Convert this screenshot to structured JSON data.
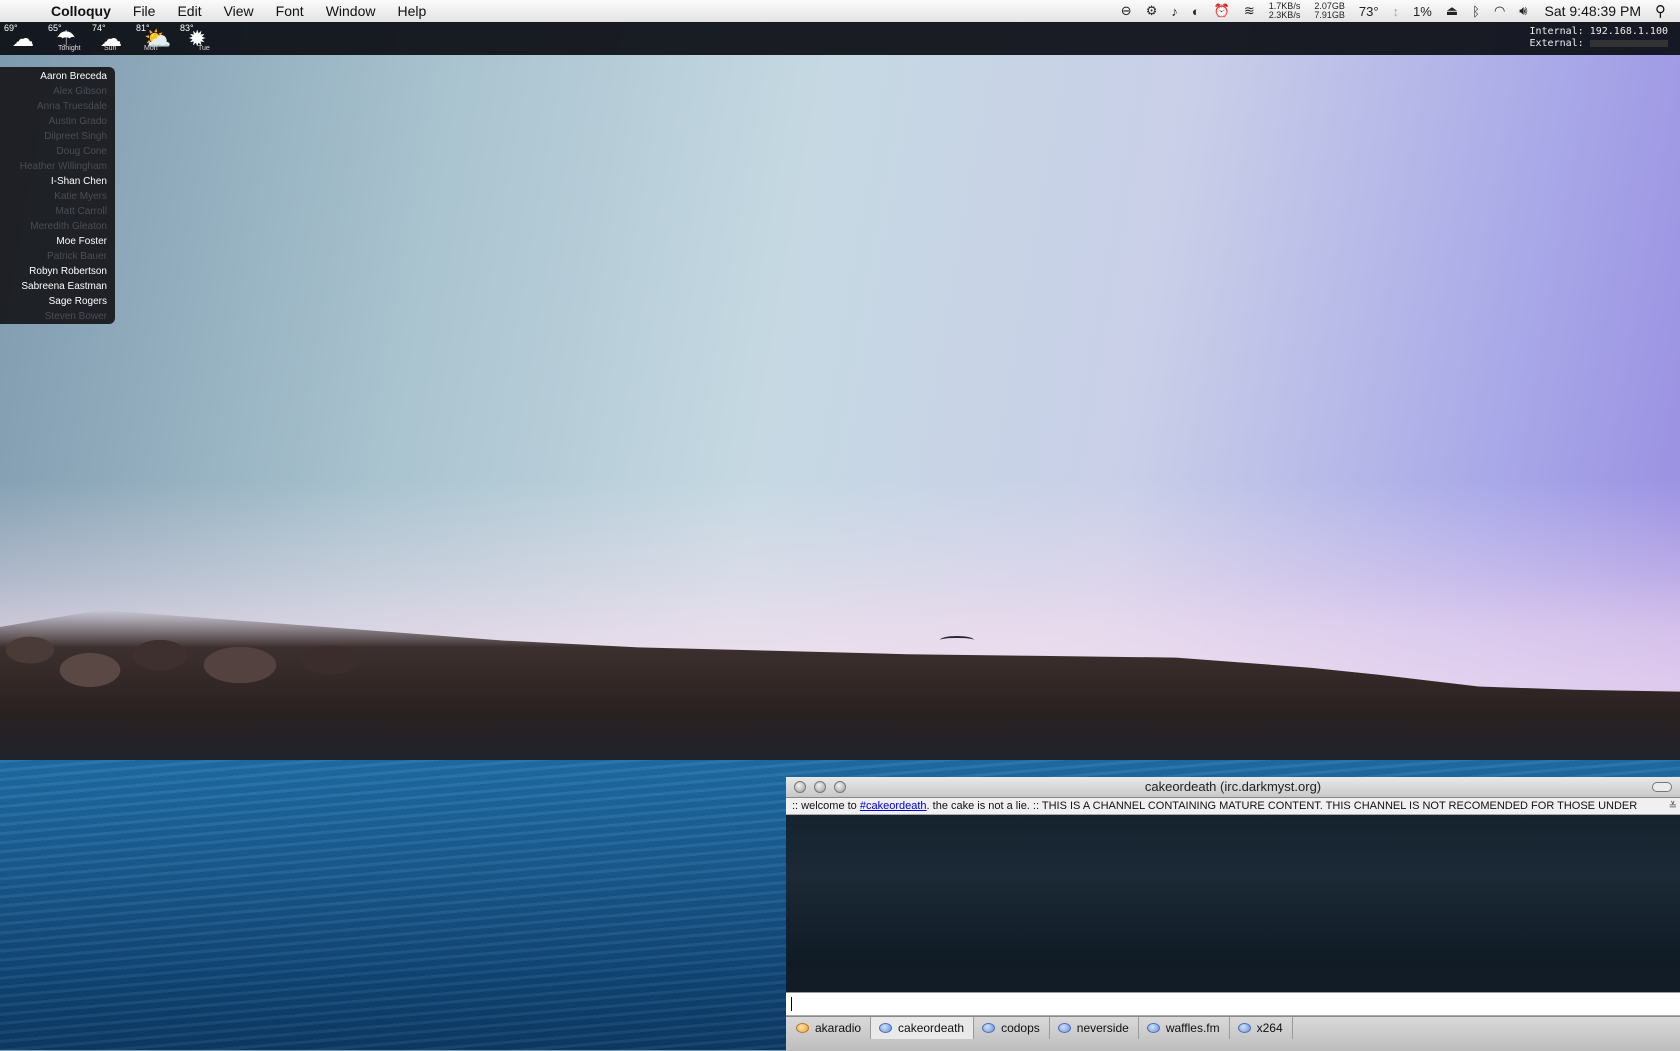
{
  "menubar": {
    "apple_icon": "",
    "app_name": "Colloquy",
    "items": [
      "File",
      "Edit",
      "View",
      "Font",
      "Window",
      "Help"
    ],
    "extras": {
      "net_up": "1.7KB/s",
      "net_down": "2.3KB/s",
      "mem_used": "2.07GB",
      "mem_free": "7.91GB",
      "temperature": "73°",
      "cpu": "1%"
    },
    "clock": "Sat 9:48:39 PM"
  },
  "weather": [
    {
      "temp": "69°",
      "label": "",
      "icon": "partly-cloudy-night-icon"
    },
    {
      "temp": "65°",
      "label": "Tonight",
      "icon": "rain-icon"
    },
    {
      "temp": "74°",
      "label": "Sun",
      "icon": "showers-icon"
    },
    {
      "temp": "81°",
      "label": "Mon",
      "icon": "partly-cloudy-icon"
    },
    {
      "temp": "83°",
      "label": "Tue",
      "icon": "sunny-icon"
    }
  ],
  "network": {
    "internal_label": "Internal:",
    "internal_ip": "192.168.1.100",
    "external_label": "External:"
  },
  "buddies": [
    {
      "name": "Aaron Breceda",
      "online": true
    },
    {
      "name": "Alex Gibson",
      "online": false
    },
    {
      "name": "Anna Truesdale",
      "online": false
    },
    {
      "name": "Austin Grado",
      "online": false
    },
    {
      "name": "Dilpreet Singh",
      "online": false
    },
    {
      "name": "Doug Cone",
      "online": false
    },
    {
      "name": "Heather Willingham",
      "online": false
    },
    {
      "name": "I-Shan Chen",
      "online": true
    },
    {
      "name": "Katie Myers",
      "online": false
    },
    {
      "name": "Matt Carroll",
      "online": false
    },
    {
      "name": "Meredith Gleaton",
      "online": false
    },
    {
      "name": "Moe Foster",
      "online": true
    },
    {
      "name": "Patrick Bauer",
      "online": false
    },
    {
      "name": "Robyn Robertson",
      "online": true
    },
    {
      "name": "Sabreena Eastman",
      "online": true
    },
    {
      "name": "Sage Rogers",
      "online": true
    },
    {
      "name": "Steven Bower",
      "online": false
    }
  ],
  "chat": {
    "title": "cakeordeath (irc.darkmyst.org)",
    "topic_prefix": ":: welcome to ",
    "topic_channel": "#cakeordeath",
    "topic_suffix": ". the cake is not a lie. :: THIS IS A CHANNEL CONTAINING MATURE CONTENT. THIS CHANNEL IS NOT RECOMENDED FOR THOSE UNDER",
    "input_value": "",
    "tabs": [
      {
        "label": "akaradio",
        "active": false,
        "icon": "orange"
      },
      {
        "label": "cakeordeath",
        "active": true,
        "icon": "blue"
      },
      {
        "label": "codops",
        "active": false,
        "icon": "blue"
      },
      {
        "label": "neverside",
        "active": false,
        "icon": "blue"
      },
      {
        "label": "waffles.fm",
        "active": false,
        "icon": "blue"
      },
      {
        "label": "x264",
        "active": false,
        "icon": "blue"
      }
    ]
  }
}
